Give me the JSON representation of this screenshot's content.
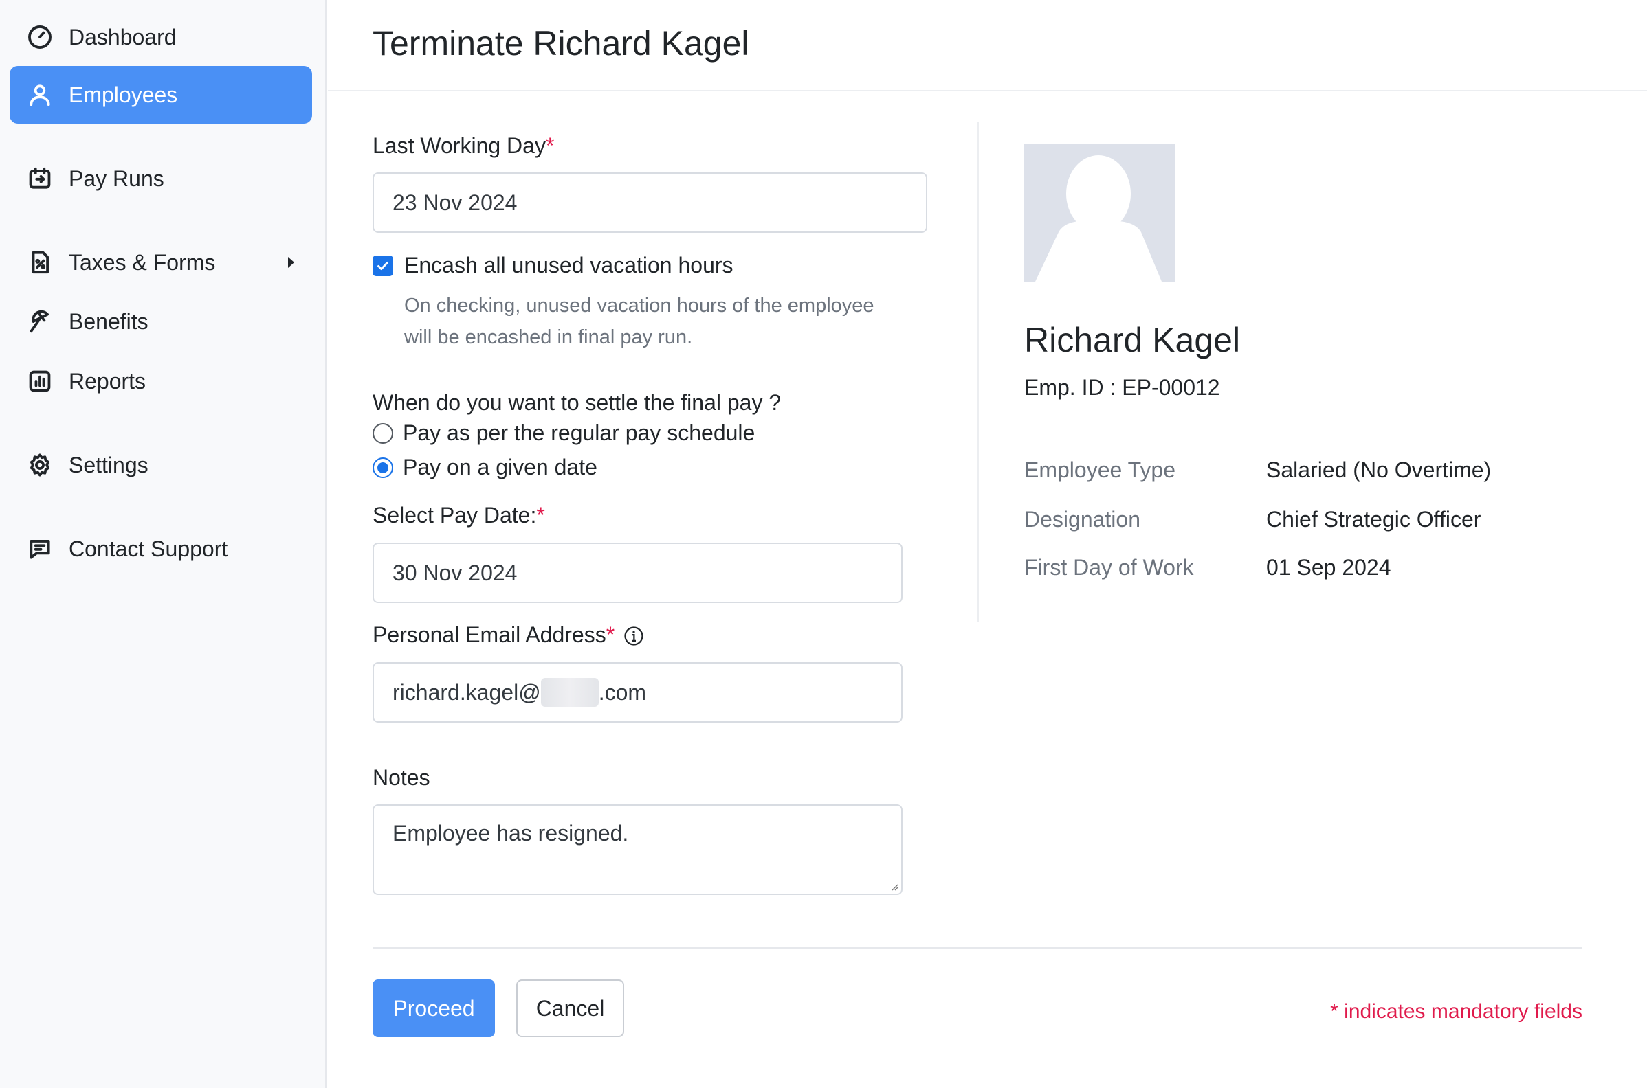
{
  "sidebar": {
    "items": [
      {
        "label": "Dashboard",
        "icon": "dashboard-gauge-icon"
      },
      {
        "label": "Employees",
        "icon": "user-icon",
        "active": true
      },
      {
        "label": "Pay Runs",
        "icon": "pay-runs-icon"
      },
      {
        "label": "Taxes & Forms",
        "icon": "tax-percent-icon",
        "has_submenu": true
      },
      {
        "label": "Benefits",
        "icon": "umbrella-icon"
      },
      {
        "label": "Reports",
        "icon": "bar-chart-icon"
      },
      {
        "label": "Settings",
        "icon": "gear-icon"
      },
      {
        "label": "Contact Support",
        "icon": "chat-icon"
      }
    ]
  },
  "header": {
    "title": "Terminate Richard Kagel"
  },
  "form": {
    "last_working_day": {
      "label": "Last Working Day",
      "required_mark": "*",
      "value": "23 Nov 2024"
    },
    "encash": {
      "label": "Encash all unused vacation hours",
      "checked": true,
      "help_line1": "On checking, unused vacation hours of the employee",
      "help_line2": "will be encashed in final pay run."
    },
    "settle": {
      "question": "When do you want to settle the final pay ?",
      "options": [
        {
          "label": "Pay as per the regular pay schedule",
          "selected": false
        },
        {
          "label": "Pay on a given date",
          "selected": true
        }
      ]
    },
    "pay_date": {
      "label": "Select Pay Date:",
      "required_mark": "*",
      "value": "30 Nov 2024"
    },
    "email": {
      "label": "Personal Email Address",
      "required_mark": "*",
      "value_prefix": "richard.kagel@",
      "value_suffix": ".com"
    },
    "notes": {
      "label": "Notes",
      "value": "Employee has resigned."
    }
  },
  "profile": {
    "name": "Richard Kagel",
    "emp_id": "Emp. ID : EP-00012",
    "details": [
      {
        "key": "Employee Type",
        "value": "Salaried (No Overtime)"
      },
      {
        "key": "Designation",
        "value": "Chief Strategic Officer"
      },
      {
        "key": "First Day of Work",
        "value": "01 Sep 2024"
      }
    ]
  },
  "actions": {
    "proceed_label": "Proceed",
    "cancel_label": "Cancel",
    "mandatory_note": "* indicates mandatory fields"
  },
  "colors": {
    "accent": "#4a90f5",
    "required": "#e01b4c",
    "control": "#1a73e8"
  }
}
